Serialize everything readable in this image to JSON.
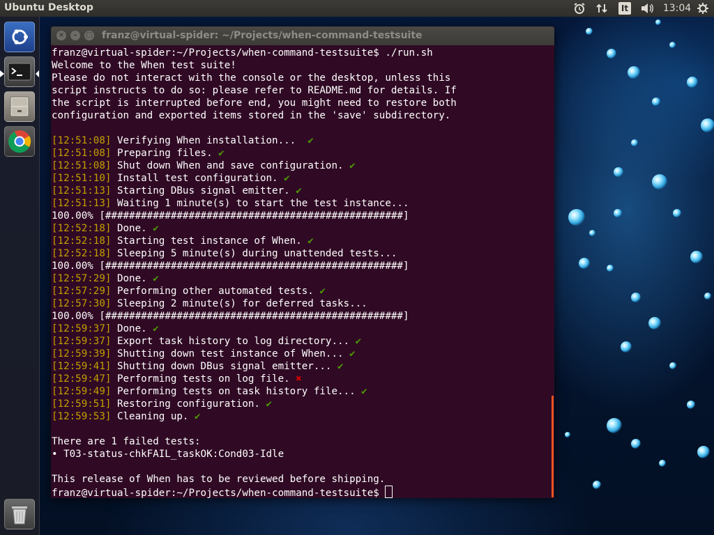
{
  "top_panel": {
    "title": "Ubuntu Desktop",
    "keyboard": "It",
    "clock": "13:04",
    "icons": [
      "alarm-clock-icon",
      "network-arrows-icon",
      "keyboard-layout-icon",
      "sound-icon",
      "settings-gear-icon"
    ]
  },
  "launcher": {
    "items": [
      "dash-ubuntu-icon",
      "terminal-icon",
      "files-cabinet-icon",
      "chrome-icon",
      "trash-icon"
    ]
  },
  "window": {
    "title": "franz@virtual-spider: ~/Projects/when-command-testsuite"
  },
  "colors": {
    "terminal_bg": "#300a24",
    "timestamp": "#c4a000",
    "ok": "#4e9a06",
    "fail": "#cc0000",
    "accent": "#e95420"
  },
  "terminal": {
    "prompt": "franz@virtual-spider:~/Projects/when-command-testsuite$",
    "command": " ./run.sh",
    "intro": [
      "Welcome to the When test suite!",
      "Please do not interact with the console or the desktop, unless this",
      "script instructs to do so: please refer to README.md for details. If",
      "the script is interrupted before end, you might need to restore both",
      "configuration and exported items stored in the 'save' subdirectory."
    ],
    "steps": [
      {
        "ts": "[12:51:08]",
        "text": " Verifying When installation...  ",
        "status": "ok"
      },
      {
        "ts": "[12:51:08]",
        "text": " Preparing files. ",
        "status": "ok"
      },
      {
        "ts": "[12:51:08]",
        "text": " Shut down When and save configuration. ",
        "status": "ok"
      },
      {
        "ts": "[12:51:10]",
        "text": " Install test configuration. ",
        "status": "ok"
      },
      {
        "ts": "[12:51:13]",
        "text": " Starting DBus signal emitter. ",
        "status": "ok"
      },
      {
        "ts": "[12:51:13]",
        "text": " Waiting 1 minute(s) to start the test instance...",
        "status": ""
      },
      {
        "progress": "100.00% [##################################################]"
      },
      {
        "ts": "[12:52:18]",
        "text": " Done. ",
        "status": "ok"
      },
      {
        "ts": "[12:52:18]",
        "text": " Starting test instance of When. ",
        "status": "ok"
      },
      {
        "ts": "[12:52:18]",
        "text": " Sleeping 5 minute(s) during unattended tests...",
        "status": ""
      },
      {
        "progress": "100.00% [##################################################]"
      },
      {
        "ts": "[12:57:29]",
        "text": " Done. ",
        "status": "ok"
      },
      {
        "ts": "[12:57:29]",
        "text": " Performing other automated tests. ",
        "status": "ok"
      },
      {
        "ts": "[12:57:30]",
        "text": " Sleeping 2 minute(s) for deferred tasks...",
        "status": ""
      },
      {
        "progress": "100.00% [##################################################]"
      },
      {
        "ts": "[12:59:37]",
        "text": " Done. ",
        "status": "ok"
      },
      {
        "ts": "[12:59:37]",
        "text": " Export task history to log directory... ",
        "status": "ok"
      },
      {
        "ts": "[12:59:39]",
        "text": " Shutting down test instance of When... ",
        "status": "ok"
      },
      {
        "ts": "[12:59:41]",
        "text": " Shutting down DBus signal emitter... ",
        "status": "ok"
      },
      {
        "ts": "[12:59:47]",
        "text": " Performing tests on log file. ",
        "status": "fail"
      },
      {
        "ts": "[12:59:49]",
        "text": " Performing tests on task history file... ",
        "status": "ok"
      },
      {
        "ts": "[12:59:51]",
        "text": " Restoring configuration. ",
        "status": "ok"
      },
      {
        "ts": "[12:59:53]",
        "text": " Cleaning up. ",
        "status": "ok"
      }
    ],
    "summary": [
      "There are 1 failed tests:",
      "• T03-status-chkFAIL_taskOK:Cond03-Idle",
      "",
      "This release of When has to be reviewed before shipping."
    ],
    "check_mark": "✔",
    "fail_mark": "✖"
  }
}
